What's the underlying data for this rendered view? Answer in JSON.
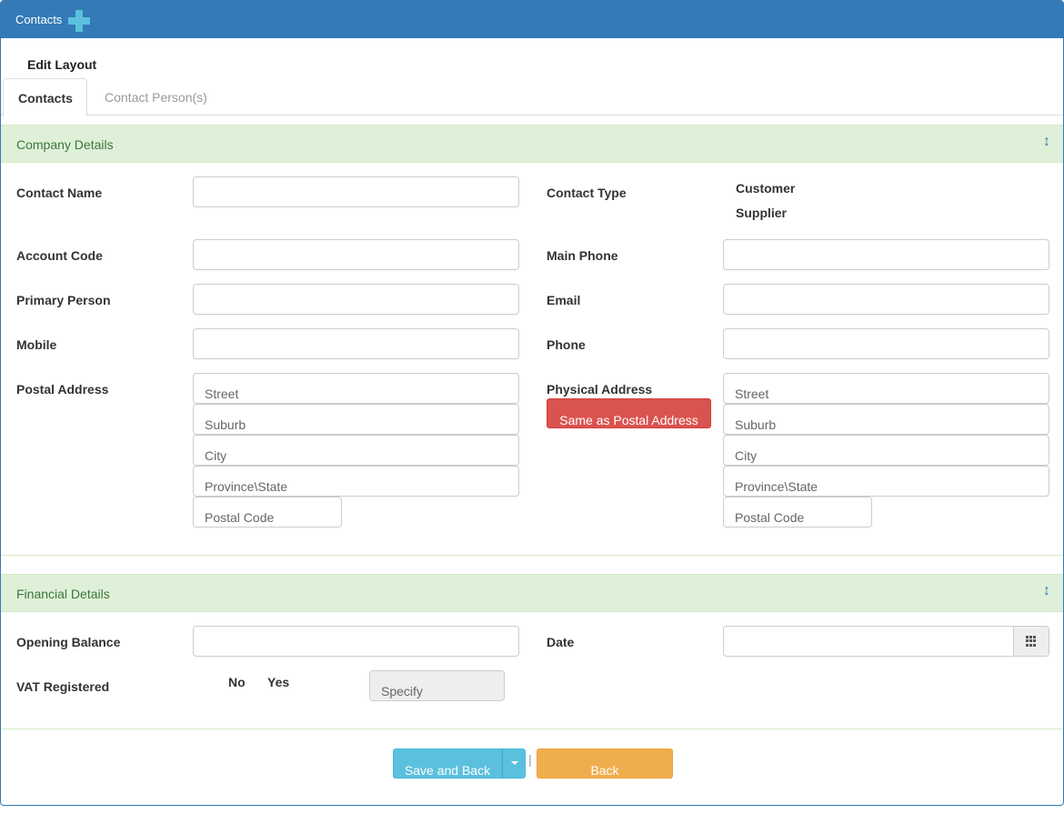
{
  "header": {
    "title": "Contacts",
    "add_icon": "plus-icon"
  },
  "edit_layout": "Edit Layout",
  "tabs": [
    {
      "label": "Contacts",
      "active": true
    },
    {
      "label": "Contact Person(s)",
      "active": false
    }
  ],
  "company": {
    "title": "Company Details",
    "toggle_icon": "↕",
    "contact_name_label": "Contact Name",
    "contact_name_value": "",
    "contact_type_label": "Contact Type",
    "contact_types": [
      "Customer",
      "Supplier"
    ],
    "account_code_label": "Account Code",
    "account_code_value": "",
    "main_phone_label": "Main Phone",
    "main_phone_value": "",
    "primary_person_label": "Primary Person",
    "primary_person_value": "",
    "email_label": "Email",
    "email_value": "",
    "mobile_label": "Mobile",
    "mobile_value": "",
    "phone_label": "Phone",
    "phone_value": "",
    "postal_address_label": "Postal Address",
    "physical_address_label": "Physical Address",
    "same_as_postal_label": "Same as Postal Address",
    "postal_placeholders": {
      "street": "Street",
      "suburb": "Suburb",
      "city": "City",
      "province": "Province\\State",
      "postal_code": "Postal Code"
    },
    "physical_placeholders": {
      "street": "Street",
      "suburb": "Suburb",
      "city": "City",
      "province": "Province\\State",
      "postal_code": "Postal Code"
    }
  },
  "financial": {
    "title": "Financial Details",
    "toggle_icon": "↕",
    "opening_balance_label": "Opening Balance",
    "opening_balance_value": "",
    "date_label": "Date",
    "date_value": "",
    "calendar_icon": "grid-calendar-icon",
    "vat_label": "VAT Registered",
    "vat_no": "No",
    "vat_yes": "Yes",
    "specify_placeholder": "Specify"
  },
  "footer": {
    "save_label": "Save and Back",
    "separator": "|",
    "back_label": "Back"
  },
  "colors": {
    "primary": "#337ab7",
    "section_bg": "#dff0d8",
    "section_text": "#3c763d",
    "danger": "#d9534f",
    "info": "#5bc0de",
    "warning": "#f0ad4e"
  }
}
